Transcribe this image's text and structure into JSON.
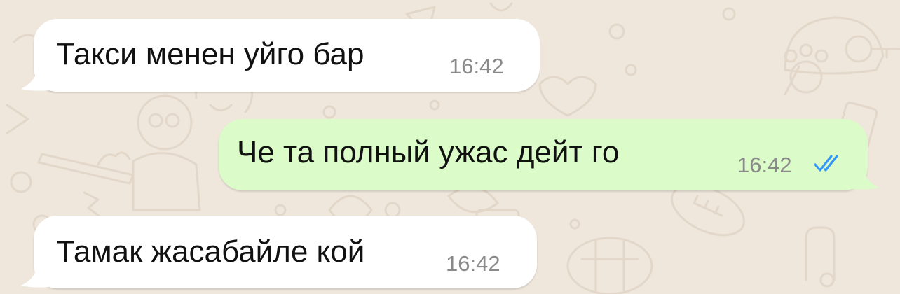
{
  "theme": {
    "wallpaper_color": "#efe7dc",
    "incoming_bubble_color": "#ffffff",
    "outgoing_bubble_color": "#dbfbc9",
    "read_tick_color": "#3497f9",
    "time_color": "#8a8a8a"
  },
  "messages": [
    {
      "direction": "incoming",
      "text": "Такси менен уйго бар",
      "time": "16:42"
    },
    {
      "direction": "outgoing",
      "text": "Че та полный ужас дейт го",
      "time": "16:42",
      "status": "read",
      "status_icon": "double-check-icon"
    },
    {
      "direction": "incoming",
      "text": "Тамак жасабайле кой",
      "time": "16:42"
    }
  ]
}
